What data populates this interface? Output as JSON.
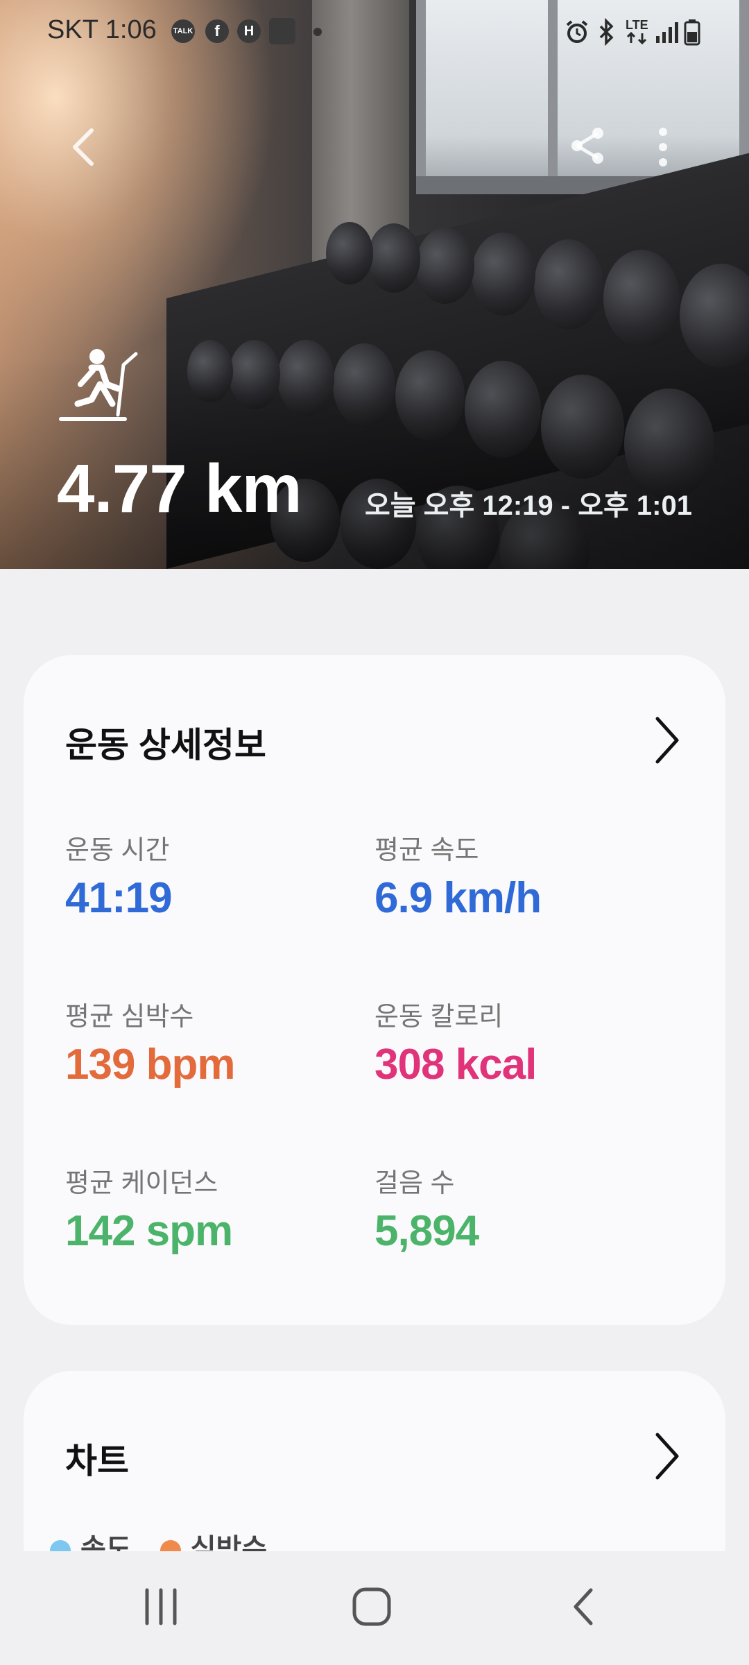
{
  "status_bar": {
    "carrier_time": "SKT 1:06",
    "notifications": [
      "talk-icon",
      "facebook-icon",
      "hyundai-icon",
      "app-icon"
    ],
    "indicators": [
      "alarm-icon",
      "bluetooth-icon",
      "lte-icon",
      "signal-icon",
      "battery-icon"
    ],
    "lte_label": "LTE"
  },
  "hero": {
    "distance": "4.77 km",
    "time_range": "오늘 오후 12:19 - 오후 1:01",
    "activity_icon": "treadmill-icon"
  },
  "details_card": {
    "title": "운동 상세정보",
    "stats": [
      {
        "label": "운동 시간",
        "value": "41:19",
        "color": "#2f6ad6"
      },
      {
        "label": "평균 속도",
        "value": "6.9 km/h",
        "color": "#2f6ad6"
      },
      {
        "label": "평균 심박수",
        "value": "139 bpm",
        "color": "#e36a3b"
      },
      {
        "label": "운동 칼로리",
        "value": "308 kcal",
        "color": "#e0337a"
      },
      {
        "label": "평균 케이던스",
        "value": "142 spm",
        "color": "#4cb46a"
      },
      {
        "label": "걸음 수",
        "value": "5,894",
        "color": "#4cb46a"
      }
    ]
  },
  "chart_card": {
    "title": "차트",
    "legend": [
      {
        "label": "속도",
        "color": "#7ec8f0"
      },
      {
        "label": "심박수",
        "color": "#f08a4b"
      }
    ]
  },
  "nav": [
    "recents-button",
    "home-button",
    "back-button"
  ]
}
